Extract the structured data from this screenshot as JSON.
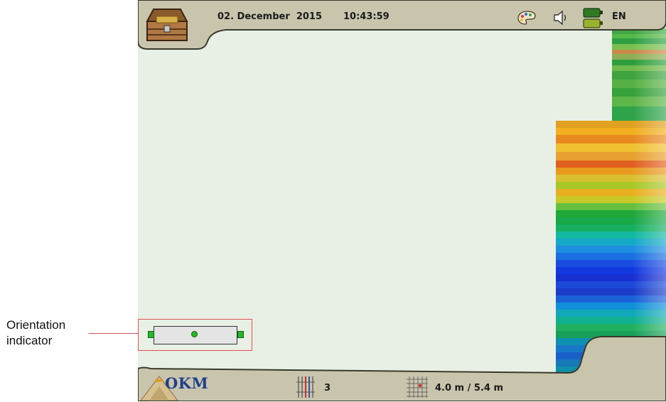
{
  "header": {
    "date": "02. December  2015",
    "time": "10:43:59",
    "language": "EN"
  },
  "footer": {
    "brand": "OKM",
    "lines_count": "3",
    "field_size": "4.0 m / 5.4 m"
  },
  "callout": {
    "line1": "Orientation",
    "line2": "indicator"
  },
  "colors": {
    "frame": "#c9c5ad",
    "frame_edge": "#3a3a2a",
    "canvas": "#e8f0e6",
    "callout_red": "#e05050",
    "sensor_green": "#22bb22",
    "battery_dark": "#2f7a23",
    "battery_light": "#99b32e"
  },
  "icons": [
    "treasure-chest-icon",
    "palette-icon",
    "speaker-icon",
    "battery-icon",
    "lines-icon",
    "grid-size-icon",
    "okm-logo"
  ]
}
